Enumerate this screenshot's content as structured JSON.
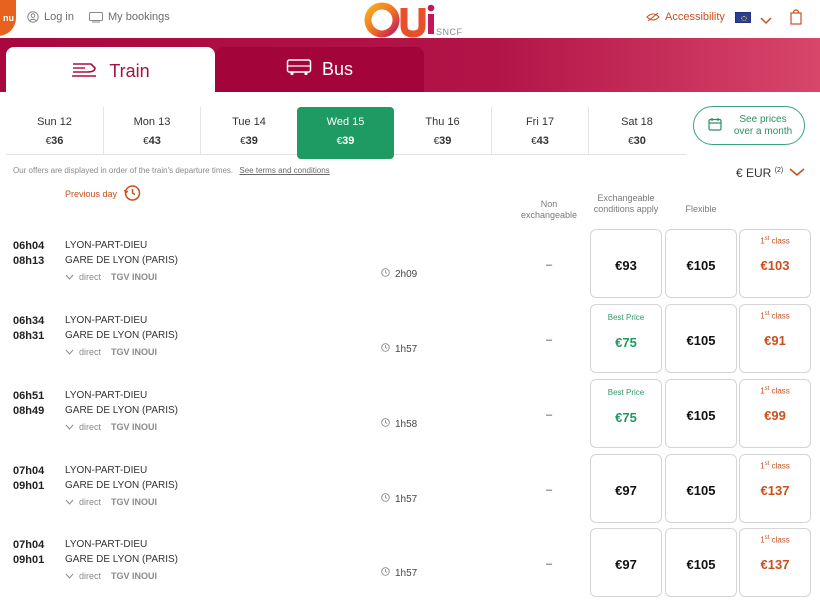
{
  "header": {
    "menu_label": "nu",
    "login_label": "Log in",
    "bookings_label": "My bookings",
    "logo_text": "Oui",
    "logo_sub": "SNCF",
    "accessibility_label": "Accessibility",
    "icons": [
      "user-icon",
      "ticket-icon",
      "eye-slash-icon",
      "eu-flag-icon",
      "chevron-down-icon",
      "shopping-bag-icon"
    ]
  },
  "modes": {
    "train_label": "Train",
    "bus_label": "Bus"
  },
  "dates": [
    {
      "day": "Sun 12",
      "price": "36"
    },
    {
      "day": "Mon 13",
      "price": "43"
    },
    {
      "day": "Tue 14",
      "price": "39"
    },
    {
      "day": "Wed 15",
      "price": "39"
    },
    {
      "day": "Thu 16",
      "price": "39"
    },
    {
      "day": "Fri 17",
      "price": "43"
    },
    {
      "day": "Sat 18",
      "price": "30"
    }
  ],
  "see_prices_label": "See prices over a month",
  "notice": {
    "text": "Our offers are displayed in order of the train's departure times.",
    "link": "See terms and conditions"
  },
  "currency": {
    "label": "€ EUR",
    "sup": "(2)"
  },
  "previous_day_label": "Previous day",
  "columns": {
    "non_exchangeable": "Non exchangeable",
    "exchangeable": "Exchangeable conditions apply",
    "flexible": "Flexible"
  },
  "labels": {
    "best_price": "Best Price",
    "first_class_num": "1",
    "first_class_sup": "st",
    "first_class_word": "class",
    "direct": "direct"
  },
  "trains": [
    {
      "dep": "06h04",
      "arr": "08h13",
      "from": "LYON-PART-DIEU",
      "to": "GARE DE LYON (PARIS)",
      "train": "TGV INOUI",
      "duration": "2h09",
      "non_exch": "–",
      "exch": "€93",
      "exch_best": false,
      "flex": "€105",
      "first": "€103"
    },
    {
      "dep": "06h34",
      "arr": "08h31",
      "from": "LYON-PART-DIEU",
      "to": "GARE DE LYON (PARIS)",
      "train": "TGV INOUI",
      "duration": "1h57",
      "non_exch": "–",
      "exch": "€75",
      "exch_best": true,
      "flex": "€105",
      "first": "€91"
    },
    {
      "dep": "06h51",
      "arr": "08h49",
      "from": "LYON-PART-DIEU",
      "to": "GARE DE LYON (PARIS)",
      "train": "TGV INOUI",
      "duration": "1h58",
      "non_exch": "–",
      "exch": "€75",
      "exch_best": true,
      "flex": "€105",
      "first": "€99"
    },
    {
      "dep": "07h04",
      "arr": "09h01",
      "from": "LYON-PART-DIEU",
      "to": "GARE DE LYON (PARIS)",
      "train": "TGV INOUI",
      "duration": "1h57",
      "non_exch": "–",
      "exch": "€97",
      "exch_best": false,
      "flex": "€105",
      "first": "€137"
    },
    {
      "dep": "07h04",
      "arr": "09h01",
      "from": "LYON-PART-DIEU",
      "to": "GARE DE LYON (PARIS)",
      "train": "TGV INOUI",
      "duration": "1h57",
      "non_exch": "–",
      "exch": "€97",
      "exch_best": false,
      "flex": "€105",
      "first": "€137"
    }
  ],
  "colors": {
    "brand": "#a8083f",
    "selected_date": "#1e9b62",
    "best_price": "#1f9a5f",
    "first_class": "#c8501e"
  }
}
